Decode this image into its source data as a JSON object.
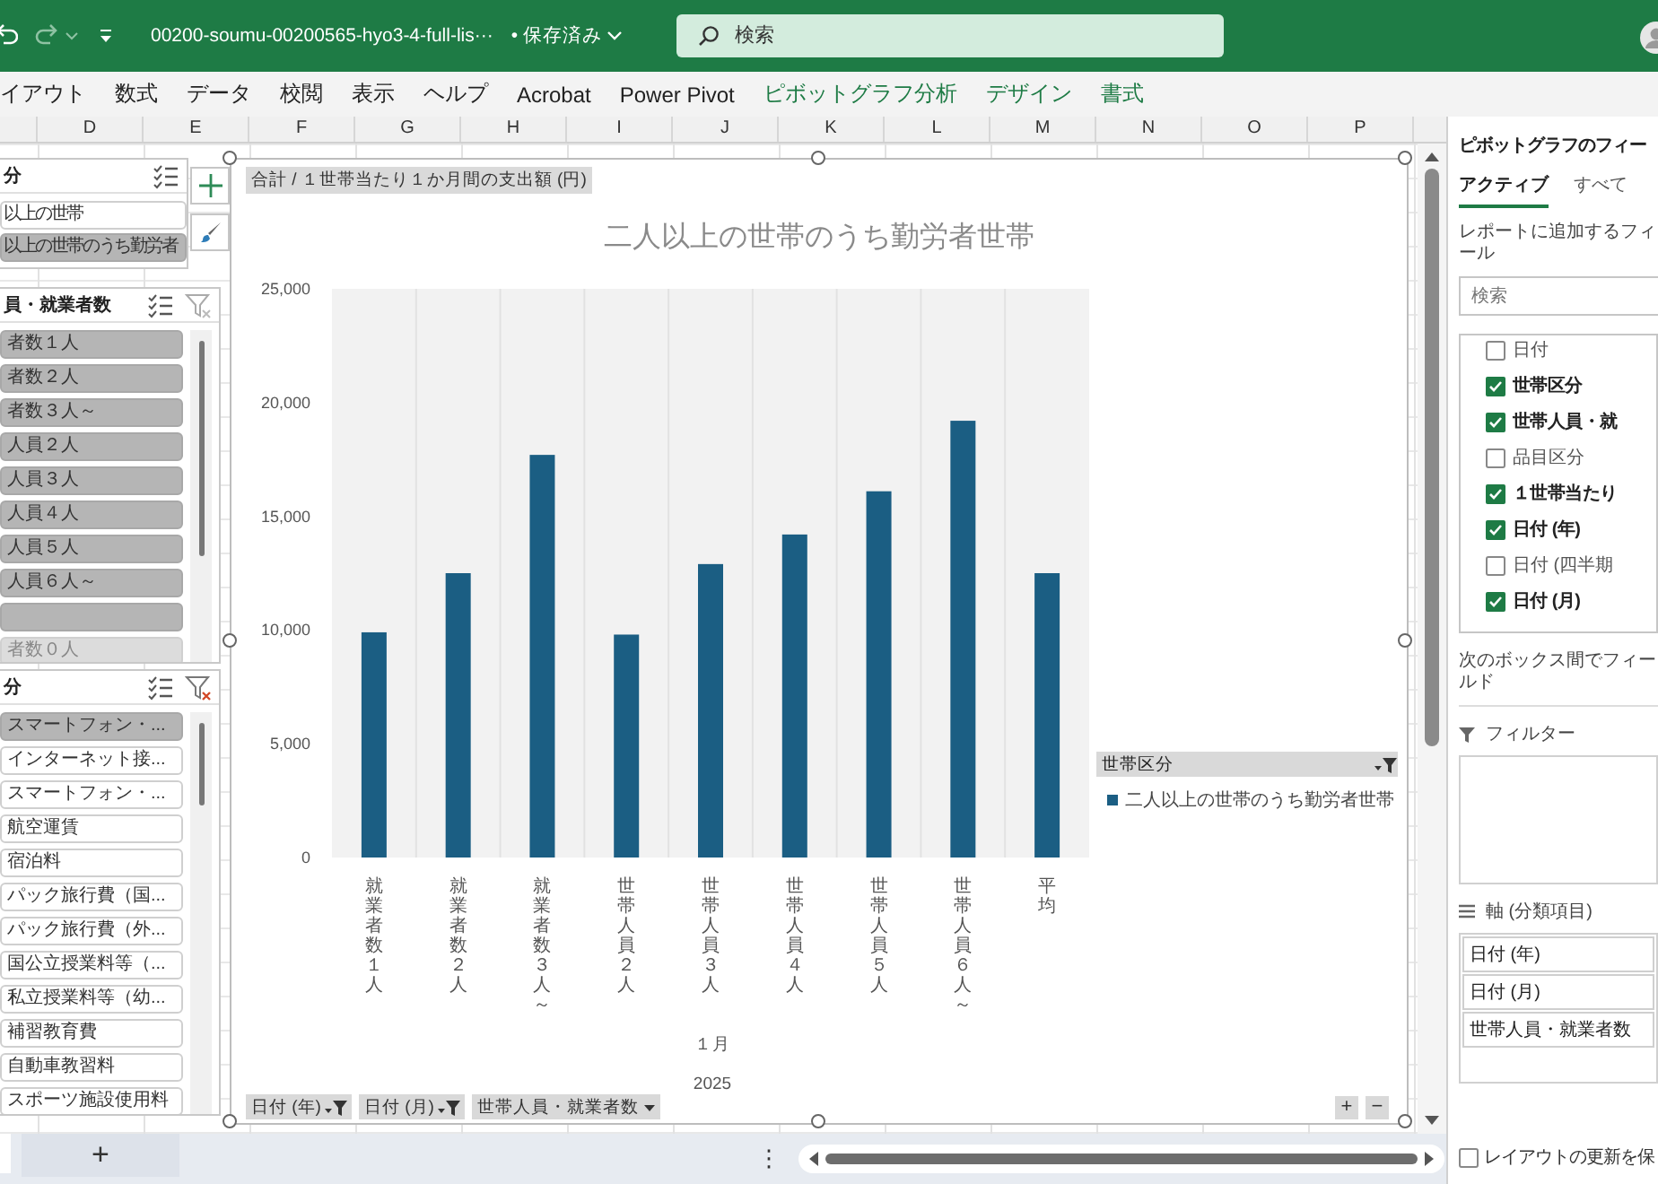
{
  "title_bar": {
    "filename": "00200-soumu-00200565-hyo3-4-full-lis···",
    "save_state": "• 保存済み",
    "search_placeholder": "検索"
  },
  "ribbon_tabs": [
    {
      "label": "イアウト",
      "kind": "normal"
    },
    {
      "label": "数式",
      "kind": "normal"
    },
    {
      "label": "データ",
      "kind": "normal"
    },
    {
      "label": "校閲",
      "kind": "normal"
    },
    {
      "label": "表示",
      "kind": "normal"
    },
    {
      "label": "ヘルプ",
      "kind": "normal"
    },
    {
      "label": "Acrobat",
      "kind": "normal"
    },
    {
      "label": "Power Pivot",
      "kind": "normal"
    },
    {
      "label": "ピボットグラフ分析",
      "kind": "contextual"
    },
    {
      "label": "デザイン",
      "kind": "contextual"
    },
    {
      "label": "書式",
      "kind": "contextual"
    }
  ],
  "columns": [
    "D",
    "E",
    "F",
    "G",
    "H",
    "I",
    "J",
    "K",
    "L",
    "M",
    "N",
    "O",
    "P"
  ],
  "slicers": [
    {
      "header": "分",
      "items": [
        {
          "label": "以上の世帯",
          "selected": false,
          "has_data": true
        },
        {
          "label": "以上の世帯のうち勤労者",
          "selected": true,
          "has_data": true
        }
      ]
    },
    {
      "header": "員・就業者数",
      "filtered": false,
      "items": [
        {
          "label": "者数１人",
          "selected": true,
          "has_data": true
        },
        {
          "label": "者数２人",
          "selected": true,
          "has_data": true
        },
        {
          "label": "者数３人～",
          "selected": true,
          "has_data": true
        },
        {
          "label": "人員２人",
          "selected": true,
          "has_data": true
        },
        {
          "label": "人員３人",
          "selected": true,
          "has_data": true
        },
        {
          "label": "人員４人",
          "selected": true,
          "has_data": true
        },
        {
          "label": "人員５人",
          "selected": true,
          "has_data": true
        },
        {
          "label": "人員６人～",
          "selected": true,
          "has_data": true
        },
        {
          "selected": true,
          "has_data": true
        },
        {
          "label": "者数０人",
          "selected": true,
          "has_data": false
        }
      ]
    },
    {
      "header": "分",
      "filtered": true,
      "items": [
        {
          "label": "スマートフォン・...",
          "selected": true,
          "has_data": true
        },
        {
          "label": "インターネット接...",
          "selected": false,
          "has_data": true
        },
        {
          "label": "スマートフォン・...",
          "selected": false,
          "has_data": true
        },
        {
          "label": "航空運賃",
          "selected": false,
          "has_data": true
        },
        {
          "label": "宿泊料",
          "selected": false,
          "has_data": true
        },
        {
          "label": "パック旅行費（国...",
          "selected": false,
          "has_data": true
        },
        {
          "label": "パック旅行費（外...",
          "selected": false,
          "has_data": true
        },
        {
          "label": "国公立授業料等（...",
          "selected": false,
          "has_data": true
        },
        {
          "label": "私立授業料等（幼...",
          "selected": false,
          "has_data": true
        },
        {
          "label": "補習教育費",
          "selected": false,
          "has_data": true
        },
        {
          "label": "自動車教習料",
          "selected": false,
          "has_data": true
        },
        {
          "label": "スポーツ施設使用料",
          "selected": false,
          "has_data": true
        }
      ]
    }
  ],
  "chart": {
    "field_button": "合計 / １世帯当たり１か月間の支出額 (円)",
    "chart_data": {
      "type": "bar",
      "title": "二人以上の世帯のうち勤労者世帯",
      "categories": [
        "就業者数１人",
        "就業者数２人",
        "就業者数３人～",
        "世帯人員２人",
        "世帯人員３人",
        "世帯人員４人",
        "世帯人員５人",
        "世帯人員６人～",
        "平均"
      ],
      "series": [
        {
          "name": "二人以上の世帯のうち勤労者世帯",
          "color": "#1b5e83",
          "values": [
            9900,
            12500,
            17700,
            9800,
            12900,
            14200,
            16100,
            19200,
            12500
          ]
        }
      ],
      "ylim": [
        0,
        25000
      ],
      "yticks": [
        {
          "value": 0,
          "label": "0"
        },
        {
          "value": 5000,
          "label": "5,000"
        },
        {
          "value": 10000,
          "label": "10,000"
        },
        {
          "value": 15000,
          "label": "15,000"
        },
        {
          "value": 20000,
          "label": "20,000"
        },
        {
          "value": 25000,
          "label": "25,000"
        }
      ]
    },
    "group_labels": [
      "１月",
      "2025"
    ],
    "legend": {
      "header": "世帯区分",
      "filtered": true
    },
    "axis_buttons": [
      {
        "label": "日付 (年)",
        "filtered": true
      },
      {
        "label": "日付 (月)",
        "filtered": true
      },
      {
        "label": "世帯人員・就業者数",
        "filtered": false
      }
    ],
    "zoom_buttons": [
      "+",
      "−"
    ]
  },
  "field_pane": {
    "title": "ピボットグラフのフィー",
    "tabs": [
      {
        "label": "アクティブ",
        "selected": true
      },
      {
        "label": "すべて",
        "selected": false
      }
    ],
    "hint": "レポートに追加するフィール",
    "search_placeholder": "検索",
    "fields": [
      {
        "label": "日付",
        "checked": false
      },
      {
        "label": "世帯区分",
        "checked": true
      },
      {
        "label": "世帯人員・就",
        "checked": true
      },
      {
        "label": "品目区分",
        "checked": false
      },
      {
        "label": "１世帯当たり",
        "checked": true
      },
      {
        "label": "日付 (年)",
        "checked": true
      },
      {
        "label": "日付 (四半期",
        "checked": false
      },
      {
        "label": "日付 (月)",
        "checked": true
      }
    ],
    "areas_hint": "次のボックス間でフィールド",
    "filter_label": "フィルター",
    "axis_label": "軸 (分類項目)",
    "axis_fields": [
      "日付 (年)",
      "日付 (月)",
      "世帯人員・就業者数"
    ],
    "defer_update": {
      "label": "レイアウトの更新を保",
      "checked": false
    }
  },
  "bottom_bar": {
    "add_sheet": "+",
    "more": "⋮"
  }
}
